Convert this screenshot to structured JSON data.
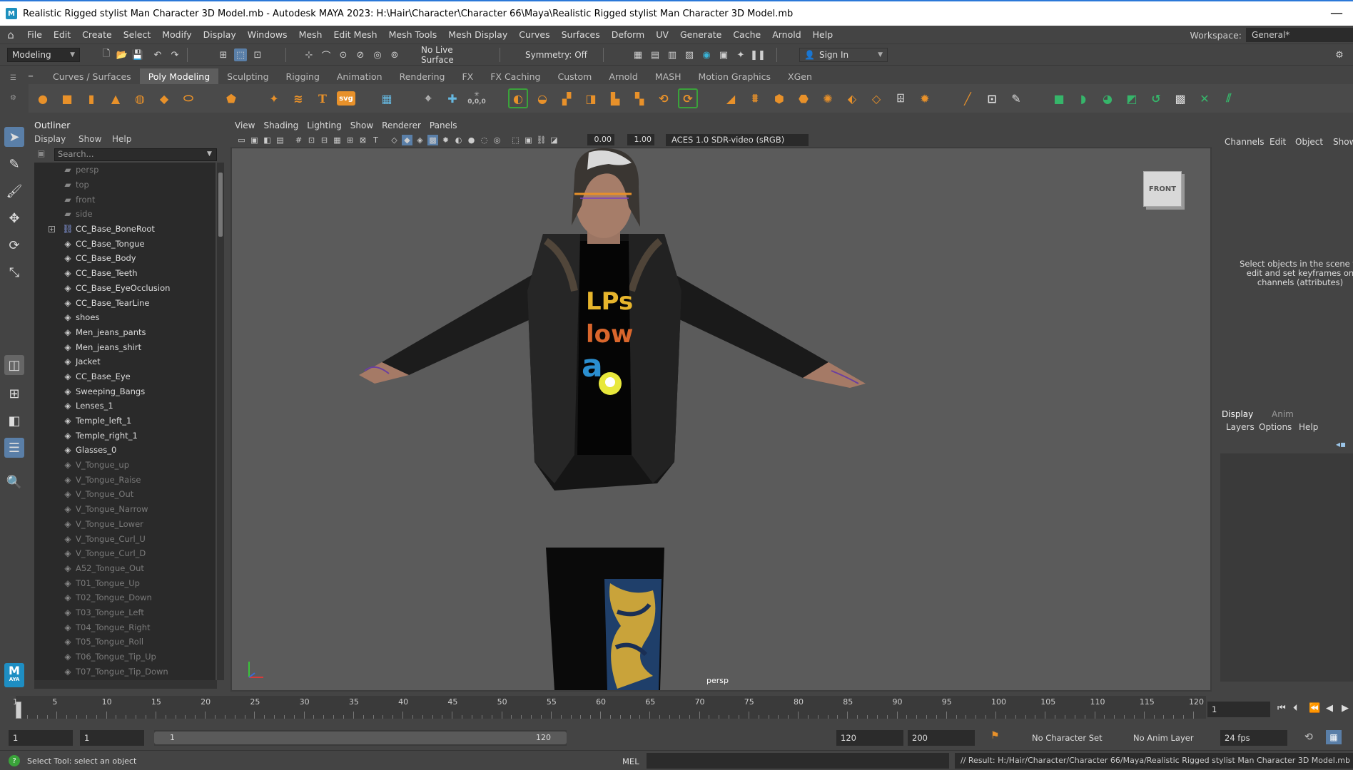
{
  "window": {
    "app_icon": "M",
    "title": "Realistic Rigged stylist Man Character 3D Model.mb - Autodesk MAYA 2023: H:\\Hair\\Character\\Character 66\\Maya\\Realistic Rigged stylist Man Character 3D Model.mb",
    "close_glyph": "—"
  },
  "menubar": {
    "items": [
      "File",
      "Edit",
      "Create",
      "Select",
      "Modify",
      "Display",
      "Windows",
      "Mesh",
      "Edit Mesh",
      "Mesh Tools",
      "Mesh Display",
      "Curves",
      "Surfaces",
      "Deform",
      "UV",
      "Generate",
      "Cache",
      "Arnold",
      "Help"
    ],
    "workspace_label": "Workspace:",
    "workspace_value": "General*"
  },
  "statusline": {
    "menuset": "Modeling",
    "live_surface": "No Live Surface",
    "symmetry": "Symmetry: Off",
    "sign_in": "Sign In"
  },
  "shelf": {
    "tabs": [
      "Curves / Surfaces",
      "Poly Modeling",
      "Sculpting",
      "Rigging",
      "Animation",
      "Rendering",
      "FX",
      "FX Caching",
      "Custom",
      "Arnold",
      "MASH",
      "Motion Graphics",
      "XGen"
    ],
    "active_tab": "Poly Modeling",
    "text_icon_label": "T",
    "svg_icon_label": "svg",
    "coord_icon_label": "0,0,0"
  },
  "outliner": {
    "title": "Outliner",
    "menus": [
      "Display",
      "Show",
      "Help"
    ],
    "search_placeholder": "Search...",
    "items": [
      {
        "label": "persp",
        "icon": "camera-icon",
        "dim": true
      },
      {
        "label": "top",
        "icon": "camera-icon",
        "dim": true
      },
      {
        "label": "front",
        "icon": "camera-icon",
        "dim": true
      },
      {
        "label": "side",
        "icon": "camera-icon",
        "dim": true
      },
      {
        "label": "CC_Base_BoneRoot",
        "icon": "joint-icon",
        "dim": false,
        "expandable": true
      },
      {
        "label": "CC_Base_Tongue",
        "icon": "mesh-icon",
        "dim": false
      },
      {
        "label": "CC_Base_Body",
        "icon": "mesh-icon",
        "dim": false
      },
      {
        "label": "CC_Base_Teeth",
        "icon": "mesh-icon",
        "dim": false
      },
      {
        "label": "CC_Base_EyeOcclusion",
        "icon": "mesh-icon",
        "dim": false
      },
      {
        "label": "CC_Base_TearLine",
        "icon": "mesh-icon",
        "dim": false
      },
      {
        "label": "shoes",
        "icon": "mesh-icon",
        "dim": false
      },
      {
        "label": "Men_jeans_pants",
        "icon": "mesh-icon",
        "dim": false
      },
      {
        "label": "Men_jeans_shirt",
        "icon": "mesh-icon",
        "dim": false
      },
      {
        "label": "Jacket",
        "icon": "mesh-icon",
        "dim": false
      },
      {
        "label": "CC_Base_Eye",
        "icon": "mesh-icon",
        "dim": false
      },
      {
        "label": "Sweeping_Bangs",
        "icon": "mesh-icon",
        "dim": false
      },
      {
        "label": "Lenses_1",
        "icon": "mesh-icon",
        "dim": false
      },
      {
        "label": "Temple_left_1",
        "icon": "mesh-icon",
        "dim": false
      },
      {
        "label": "Temple_right_1",
        "icon": "mesh-icon",
        "dim": false
      },
      {
        "label": "Glasses_0",
        "icon": "mesh-icon",
        "dim": false
      },
      {
        "label": "V_Tongue_up",
        "icon": "mesh-icon",
        "dim": true
      },
      {
        "label": "V_Tongue_Raise",
        "icon": "mesh-icon",
        "dim": true
      },
      {
        "label": "V_Tongue_Out",
        "icon": "mesh-icon",
        "dim": true
      },
      {
        "label": "V_Tongue_Narrow",
        "icon": "mesh-icon",
        "dim": true
      },
      {
        "label": "V_Tongue_Lower",
        "icon": "mesh-icon",
        "dim": true
      },
      {
        "label": "V_Tongue_Curl_U",
        "icon": "mesh-icon",
        "dim": true
      },
      {
        "label": "V_Tongue_Curl_D",
        "icon": "mesh-icon",
        "dim": true
      },
      {
        "label": "A52_Tongue_Out",
        "icon": "mesh-icon",
        "dim": true
      },
      {
        "label": "T01_Tongue_Up",
        "icon": "mesh-icon",
        "dim": true
      },
      {
        "label": "T02_Tongue_Down",
        "icon": "mesh-icon",
        "dim": true
      },
      {
        "label": "T03_Tongue_Left",
        "icon": "mesh-icon",
        "dim": true
      },
      {
        "label": "T04_Tongue_Right",
        "icon": "mesh-icon",
        "dim": true
      },
      {
        "label": "T05_Tongue_Roll",
        "icon": "mesh-icon",
        "dim": true
      },
      {
        "label": "T06_Tongue_Tip_Up",
        "icon": "mesh-icon",
        "dim": true
      },
      {
        "label": "T07_Tongue_Tip_Down",
        "icon": "mesh-icon",
        "dim": true
      }
    ]
  },
  "viewport": {
    "menus": [
      "View",
      "Shading",
      "Lighting",
      "Show",
      "Renderer",
      "Panels"
    ],
    "exposure": "0.00",
    "gamma": "1.00",
    "color_space": "ACES 1.0 SDR-video (sRGB)",
    "view_cube": "FRONT",
    "camera": "persp",
    "shirt_text_1": "LPs",
    "shirt_text_2": "low",
    "shirt_text_3": "a"
  },
  "channelbox": {
    "menus": [
      "Channels",
      "Edit",
      "Object",
      "Show"
    ],
    "message": "Select objects in the scene to edit and set keyframes on channels (attributes)"
  },
  "layers": {
    "tabs": [
      "Display",
      "Anim"
    ],
    "menus": [
      "Layers",
      "Options",
      "Help"
    ]
  },
  "timeline": {
    "ticks": [
      1,
      5,
      10,
      15,
      20,
      25,
      30,
      35,
      40,
      45,
      50,
      55,
      60,
      65,
      70,
      75,
      80,
      85,
      90,
      95,
      100,
      105,
      110,
      115,
      120
    ],
    "current_frame": "1",
    "end_tick_max": 120
  },
  "range": {
    "start": "1",
    "playback_start": "1",
    "range_start": "1",
    "range_end": "120",
    "playback_end": "120",
    "anim_end": "200",
    "character_set": "No Character Set",
    "anim_layer": "No Anim Layer",
    "fps": "24 fps"
  },
  "commandline": {
    "help_text": "Select Tool: select an object",
    "mode": "MEL",
    "result": "// Result: H:/Hair/Character/Character 66/Maya/Realistic Rigged stylist Man Character 3D Model.mb"
  },
  "logo": {
    "main": "M",
    "sub": "AYA"
  },
  "colors": {
    "accent_blue": "#2b78d8",
    "highlight_green": "#3aa33a",
    "shelf_orange": "#e8912a",
    "shelf_green": "#36b56a",
    "viewport_bg": "#5b5b5b"
  }
}
